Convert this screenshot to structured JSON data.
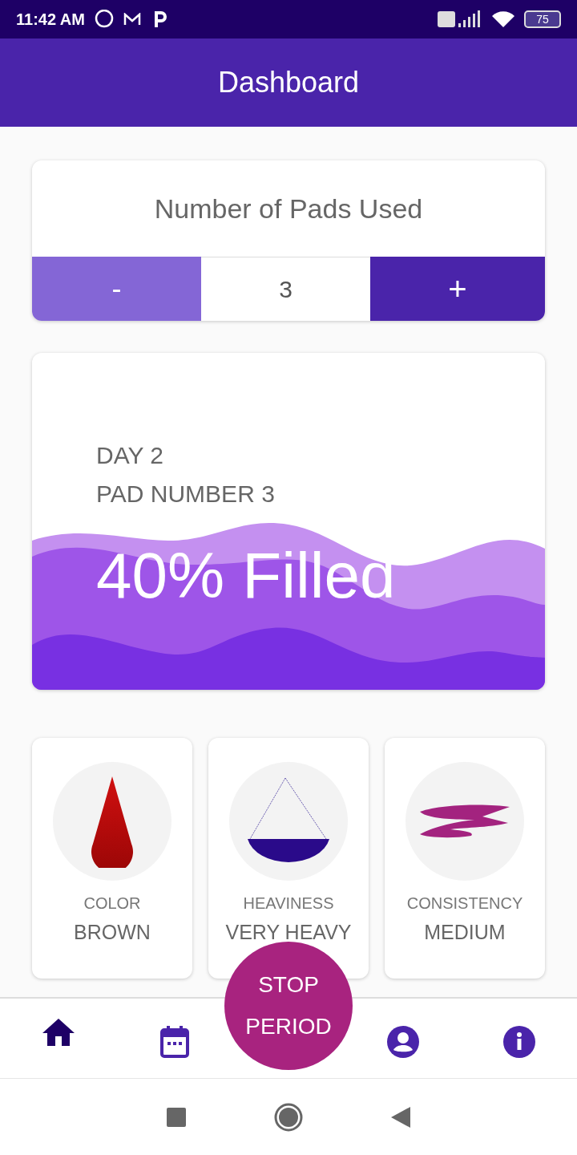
{
  "status_bar": {
    "time": "11:42 AM",
    "battery": "75"
  },
  "header": {
    "title": "Dashboard"
  },
  "pads_card": {
    "title": "Number of Pads Used",
    "minus": "-",
    "count": "3",
    "plus": "+"
  },
  "fill_card": {
    "day": "DAY 2",
    "pad": "PAD NUMBER 3",
    "filled": "40% Filled"
  },
  "stats": [
    {
      "kind": "drop",
      "label": "COLOR",
      "value": "BROWN"
    },
    {
      "kind": "bowl",
      "label": "HEAVINESS",
      "value": "VERY HEAVY"
    },
    {
      "kind": "smear",
      "label": "CONSISTENCY",
      "value": "MEDIUM"
    }
  ],
  "fab": {
    "line1": "STOP",
    "line2": "PERIOD"
  },
  "nav": [
    {
      "kind": "home",
      "selected": true
    },
    {
      "kind": "calendar",
      "selected": false
    },
    {
      "kind": "profile",
      "selected": false
    },
    {
      "kind": "info",
      "selected": false
    }
  ]
}
